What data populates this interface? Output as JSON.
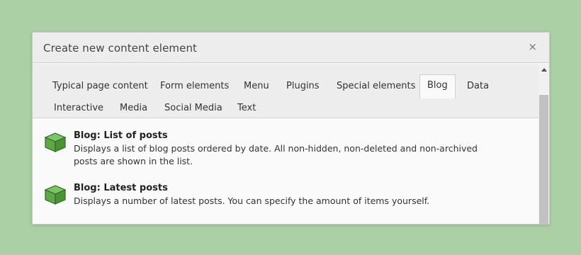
{
  "dialog": {
    "title": "Create new content element",
    "close_label": "×"
  },
  "tabs": [
    {
      "label": "Typical page content"
    },
    {
      "label": "Form elements"
    },
    {
      "label": "Menu"
    },
    {
      "label": "Plugins"
    },
    {
      "label": "Special elements"
    },
    {
      "label": "Blog",
      "active": true
    },
    {
      "label": "Data"
    },
    {
      "label": "Interactive"
    },
    {
      "label": "Media"
    },
    {
      "label": "Social Media"
    },
    {
      "label": "Text"
    }
  ],
  "items": [
    {
      "title": "Blog: List of posts",
      "description": "Displays a list of blog posts ordered by date. All non-hidden, non-deleted and non-archived posts are shown in the list.",
      "icon": "cube-icon"
    },
    {
      "title": "Blog: Latest posts",
      "description": "Displays a number of latest posts. You can specify the amount of items yourself.",
      "icon": "cube-icon"
    }
  ],
  "colors": {
    "background": "#acd0a5",
    "icon_green": "#5fa84a",
    "icon_dark": "#2e6a26"
  }
}
